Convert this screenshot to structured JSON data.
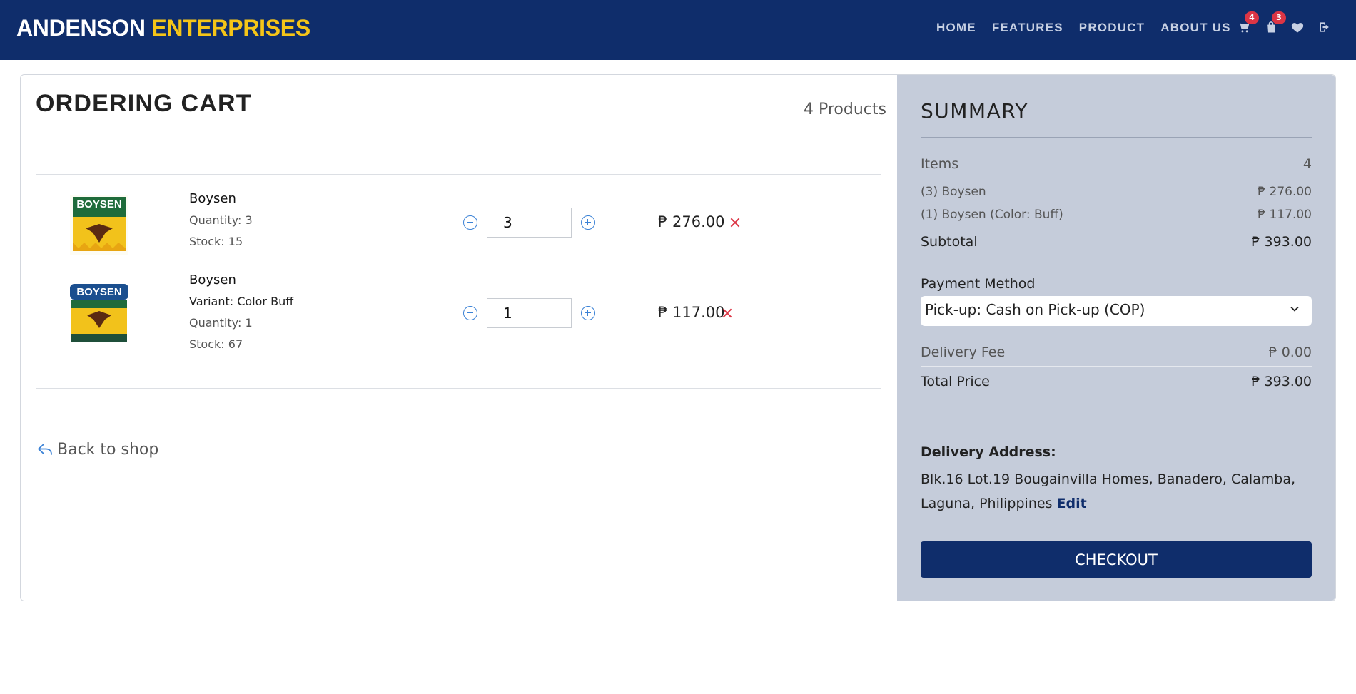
{
  "brand": {
    "part1": "ANDENSON",
    "part2": "ENTERPRISES"
  },
  "nav": {
    "links": [
      "HOME",
      "FEATURES",
      "PRODUCT",
      "ABOUT US"
    ],
    "icons": [
      {
        "name": "cart-icon",
        "badge": "4"
      },
      {
        "name": "bag-icon",
        "badge": "3"
      },
      {
        "name": "heart-icon",
        "badge": ""
      },
      {
        "name": "logout-icon",
        "badge": ""
      }
    ]
  },
  "cart": {
    "title": "ORDERING CART",
    "product_count": "4 Products",
    "items": [
      {
        "name": "Boysen",
        "variant": "",
        "quantity_text": "Quantity: 3",
        "stock_text": "Stock: 15",
        "qty_value": "3",
        "price": "₱ 276.00",
        "image_label": "BOYSEN"
      },
      {
        "name": "Boysen",
        "variant": "Variant: Color Buff",
        "quantity_text": "Quantity: 1",
        "stock_text": "Stock: 67",
        "qty_value": "1",
        "price": "₱ 117.00",
        "image_label": "BOYSEN"
      }
    ],
    "back_label": "Back to shop"
  },
  "summary": {
    "title": "SUMMARY",
    "items_label": "Items",
    "items_value": "4",
    "lines": [
      {
        "label": "(3) Boysen",
        "value": "₱ 276.00"
      },
      {
        "label": "(1) Boysen (Color: Buff)",
        "value": "₱ 117.00"
      }
    ],
    "subtotal_label": "Subtotal",
    "subtotal_value": "₱ 393.00",
    "payment_label": "Payment Method",
    "payment_selected": "Pick-up: Cash on Pick-up (COP)",
    "delivery_fee_label": "Delivery Fee",
    "delivery_fee_value": "₱ 0.00",
    "total_label": "Total Price",
    "total_value": "₱ 393.00",
    "address_title": "Delivery Address:",
    "address_text": "Blk.16 Lot.19 Bougainvilla Homes, Banadero, Calamba, Laguna, Philippines",
    "address_edit": "Edit",
    "checkout_label": "CHECKOUT"
  },
  "colors": {
    "navbar": "#0f2d6b",
    "brand_accent": "#f5c518",
    "summary_bg": "#c5ccda",
    "badge": "#dc3545",
    "link_blue": "#3b82d6"
  }
}
